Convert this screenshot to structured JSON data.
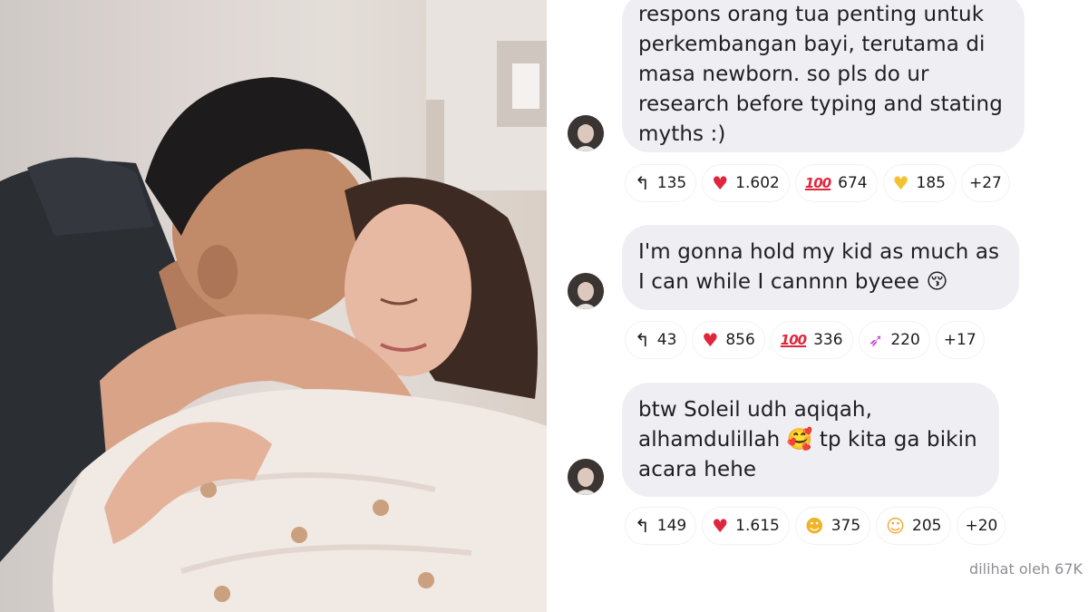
{
  "comments": [
    {
      "lines": [
        "respons orang tua penting untuk",
        "perkembangan bayi, terutama di",
        "masa newborn. so pls do ur",
        "research before typing and stating",
        "myths :)"
      ],
      "reactions": {
        "reply": "135",
        "r1_icon": "heart-icon",
        "r1_count": "1.602",
        "r2_icon": "hundred-icon",
        "r2_count": "674",
        "r3_icon": "yellow-heart-icon",
        "r3_count": "185",
        "more": "+27"
      }
    },
    {
      "lines": [
        "I'm gonna hold my kid as much as",
        "I can while I cannnn byeee 😚"
      ],
      "reactions": {
        "reply": "43",
        "r1_icon": "heart-icon",
        "r1_count": "856",
        "r2_icon": "hundred-icon",
        "r2_count": "336",
        "r3_icon": "rocket-icon",
        "r3_count": "220",
        "more": "+17"
      }
    },
    {
      "lines": [
        "btw Soleil udh aqiqah,",
        "alhamdulillah 🥰 tp kita ga bikin",
        "acara hehe"
      ],
      "reactions": {
        "reply": "149",
        "r1_icon": "heart-icon",
        "r1_count": "1.615",
        "r2_icon": "heart-eyes-icon",
        "r2_count": "375",
        "r3_icon": "smiling-hearts-icon",
        "r3_count": "205",
        "more": "+20"
      }
    }
  ],
  "viewed_by": "dilihat oleh 67K",
  "colors": {
    "bubble": "#efeff3",
    "heart": "#e0263c",
    "muted": "#8e8e93"
  }
}
